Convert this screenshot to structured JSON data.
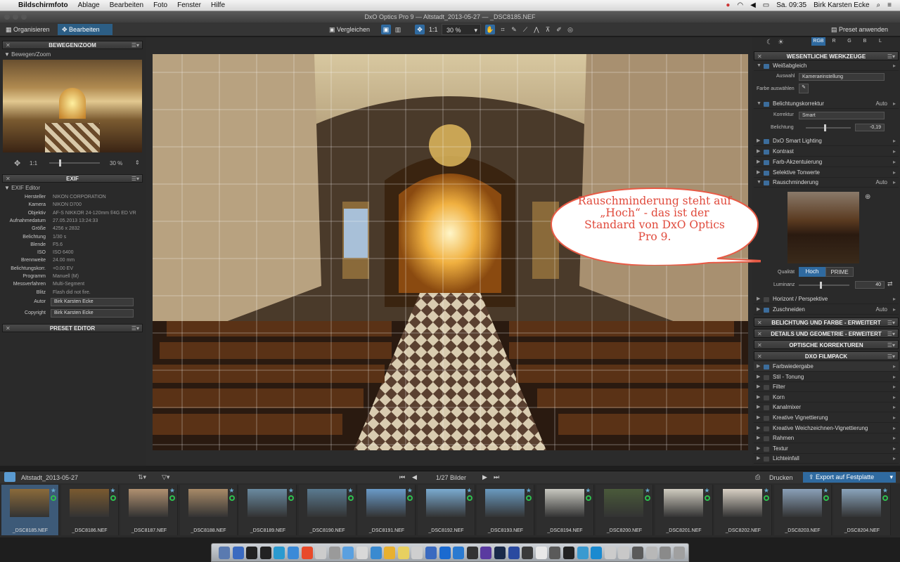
{
  "menubar": {
    "app": "Bildschirmfoto",
    "items": [
      "Ablage",
      "Bearbeiten",
      "Foto",
      "Fenster",
      "Hilfe"
    ],
    "clock": "Sa. 09:35",
    "user": "Birk Karsten Ecke"
  },
  "window": {
    "title": "DxO Optics Pro 9 — Altstadt_2013-05-27 — _DSC8185.NEF"
  },
  "toolbar": {
    "organize_label": "Organisieren",
    "edit_label": "Bearbeiten",
    "compare_label": "Vergleichen",
    "ratio_label": "1:1",
    "zoom_value": "30 %",
    "apply_preset_label": "Preset anwenden"
  },
  "left": {
    "move_zoom_title": "BEWEGEN/ZOOM",
    "move_zoom_sub": "Bewegen/Zoom",
    "ratio": "1:1",
    "zoom_value": "30 %",
    "exif_title": "EXIF",
    "exif_sub": "EXIF Editor",
    "exif_rows": [
      {
        "k": "Hersteller",
        "v": "NIKON CORPORATION"
      },
      {
        "k": "Kamera",
        "v": "NIKON D700"
      },
      {
        "k": "Objektiv",
        "v": "AF-S NIKKOR 24-120mm f/4G ED VR"
      },
      {
        "k": "Aufnahmedatum",
        "v": "27.05.2013 13:24:33"
      },
      {
        "k": "Größe",
        "v": "4256 x 2832"
      },
      {
        "k": "Belichtung",
        "v": "1/30 s"
      },
      {
        "k": "Blende",
        "v": "F5.6"
      },
      {
        "k": "ISO",
        "v": "ISO 6400"
      },
      {
        "k": "Brennweite",
        "v": "24.00 mm"
      },
      {
        "k": "Belichtungskorr.",
        "v": "+0.00 EV"
      },
      {
        "k": "Programm",
        "v": "Manuell (M)"
      },
      {
        "k": "Messverfahren",
        "v": "Multi-Segment"
      },
      {
        "k": "Blitz",
        "v": "Flash did not fire."
      }
    ],
    "author_label": "Autor",
    "author_value": "Birk Karsten Ecke",
    "copyright_label": "Copyright",
    "copyright_value": "Birk Karsten Ecke",
    "preset_editor_title": "PRESET EDITOR"
  },
  "right": {
    "channels": [
      "RGB",
      "R",
      "G",
      "B",
      "L"
    ],
    "essential_title": "WESENTLICHE WERKZEUGE",
    "white_balance": "Weißabgleich",
    "selection_label": "Auswahl",
    "selection_value": "Kameraeinstellung",
    "pick_color_label": "Farbe auswählen",
    "exposure_comp": "Belichtungskorrektur",
    "exposure_auto": "Auto",
    "correction_label": "Korrektur",
    "correction_value": "Smart",
    "exposure_label": "Belichtung",
    "exposure_value": "-0,19",
    "smart_lighting": "DxO Smart Lighting",
    "contrast": "Kontrast",
    "color_accent": "Farb-Akzentuierung",
    "selective_tone": "Selektive Tonwerte",
    "noise_reduction": "Rauschminderung",
    "noise_auto": "Auto",
    "quality_label": "Qualität",
    "quality_high": "Hoch",
    "quality_prime": "PRIME",
    "luminance_label": "Luminanz",
    "luminance_value": "40",
    "horizon": "Horizont / Perspektive",
    "crop": "Zuschneiden",
    "crop_auto": "Auto",
    "sections": [
      "BELICHTUNG UND FARBE - ERWEITERT",
      "DETAILS UND GEOMETRIE - ERWEITERT",
      "OPTISCHE KORREKTUREN",
      "DXO FILMPACK"
    ],
    "filmpack_tools": [
      "Farbwiedergabe",
      "Stil - Tonung",
      "Filter",
      "Korn",
      "Kanalmixer",
      "Kreative Vignettierung",
      "Kreative Weichzeichnen-Vignettierung",
      "Rahmen",
      "Textur",
      "Lichteinfall"
    ]
  },
  "callout": {
    "lines": [
      "Rauschminderung steht auf",
      "„Hoch“ - das ist der",
      "Standard von DxO Optics",
      "Pro 9."
    ]
  },
  "filmstrip": {
    "folder": "Altstadt_2013-05-27",
    "counter": "1/27 Bilder",
    "print_label": "Drucken",
    "export_label": "Export auf Festplatte",
    "images": [
      "_DSC8185.NEF",
      "_DSC8186.NEF",
      "_DSC8187.NEF",
      "_DSC8188.NEF",
      "_DSC8189.NEF",
      "_DSC8190.NEF",
      "_DSC8191.NEF",
      "_DSC8192.NEF",
      "_DSC8193.NEF",
      "_DSC8194.NEF",
      "_DSC8200.NEF",
      "_DSC8201.NEF",
      "_DSC8202.NEF",
      "_DSC8203.NEF",
      "_DSC8204.NEF"
    ]
  }
}
